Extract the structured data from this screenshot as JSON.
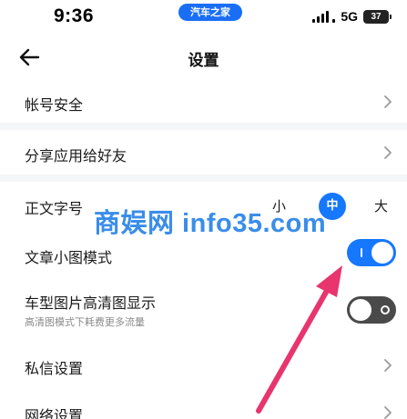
{
  "status_bar": {
    "time": "9:36",
    "app_badge": "汽车之家",
    "network": "5G",
    "battery": "37"
  },
  "header": {
    "title": "设置"
  },
  "settings": {
    "account_security": "帐号安全",
    "share_app": "分享应用给好友",
    "font_size": {
      "label": "正文字号",
      "options": [
        "小",
        "中",
        "大"
      ],
      "selected": "中"
    },
    "article_thumbnail_mode": {
      "label": "文章小图模式",
      "enabled": true
    },
    "car_image_hd": {
      "label": "车型图片高清图显示",
      "sublabel": "高清图模式下耗费更多流量",
      "enabled": false
    },
    "private_message": "私信设置",
    "network": "网络设置"
  },
  "watermark": "商娱网 info35.com",
  "colors": {
    "accent": "#1677ff",
    "toggle_off": "#4a4a4a",
    "annotation_arrow": "#e8356e"
  }
}
